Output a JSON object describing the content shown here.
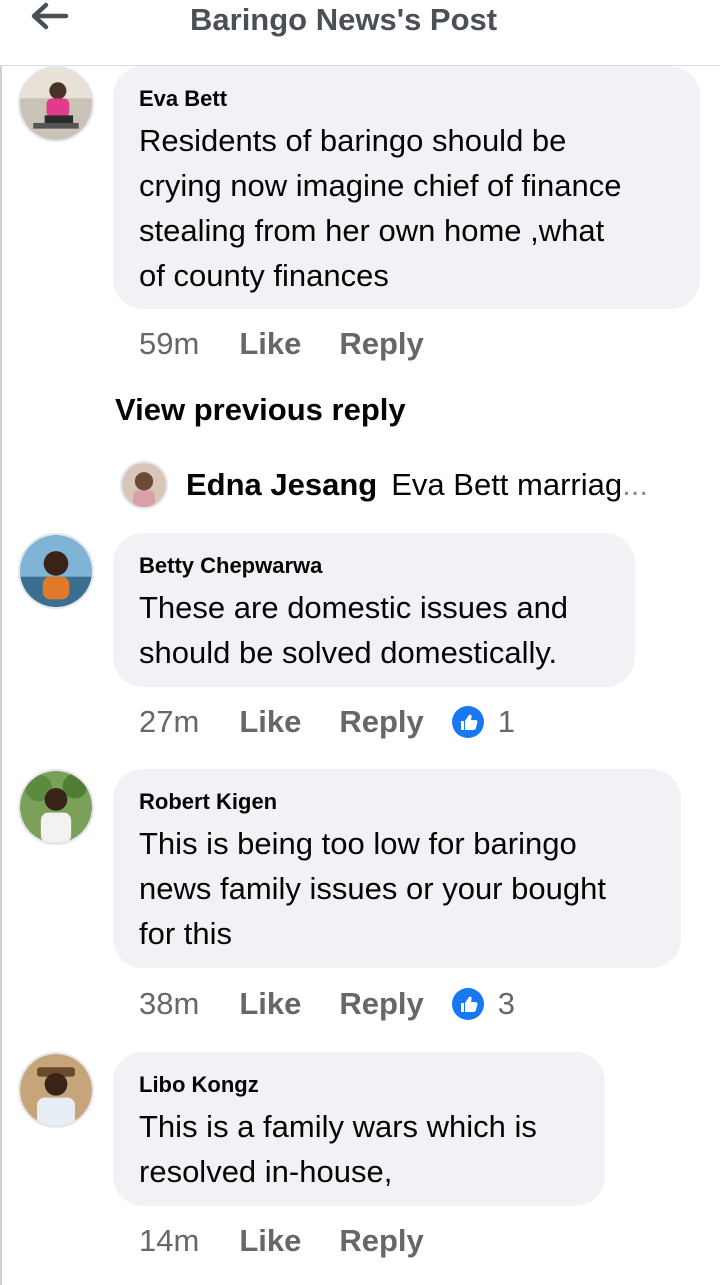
{
  "header": {
    "title": "Baringo News's Post",
    "back_icon": "arrow-left-icon"
  },
  "comments": [
    {
      "author": "Eva Bett",
      "lines": [
        "Residents of baringo should be",
        "crying now imagine chief of finance",
        "stealing from her own home ,what",
        "of county finances"
      ],
      "time": "59m",
      "like_label": "Like",
      "reply_label": "Reply"
    },
    {
      "author": "Betty Chepwarwa",
      "lines": [
        "These are domestic issues and",
        "should be solved domestically."
      ],
      "time": "27m",
      "like_label": "Like",
      "reply_label": "Reply",
      "reaction_count": "1"
    },
    {
      "author": "Robert Kigen",
      "lines": [
        "This is being too low for baringo",
        "news family issues or your bought",
        "for this"
      ],
      "time": "38m",
      "like_label": "Like",
      "reply_label": "Reply",
      "reaction_count": "3"
    },
    {
      "author": "Libo Kongz",
      "lines": [
        "This is a family wars which is",
        "resolved in-house,"
      ],
      "time": "14m",
      "like_label": "Like",
      "reply_label": "Reply"
    }
  ],
  "view_previous_reply": "View previous reply",
  "reply_preview": {
    "author": "Edna Jesang",
    "text": "Eva Bett  marriag",
    "ellipsis": "..."
  },
  "colors": {
    "bubble": "#f0f2f5",
    "secondary_text": "#65676b",
    "like_blue": "#1877f2",
    "header_title": "#4b4f56"
  }
}
